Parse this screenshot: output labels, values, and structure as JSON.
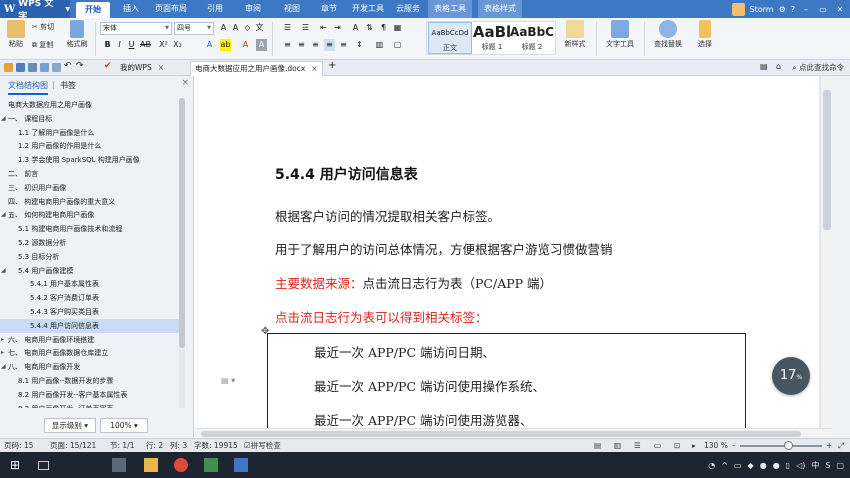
{
  "titlebar": {
    "app_name": "WPS 文字",
    "tabs": [
      "开始",
      "插入",
      "页面布局",
      "引用",
      "审阅",
      "视图",
      "章节",
      "开发工具",
      "云服务",
      "表格工具",
      "表格样式"
    ],
    "active_tab": "开始",
    "user": "Storm",
    "help": "?"
  },
  "ribbon": {
    "paste": "粘贴",
    "cut": "剪切",
    "copy": "复制",
    "format_painter": "格式刷",
    "font_name": "宋体",
    "font_size": "四号",
    "styles": [
      {
        "sample": "AaBbCcDd",
        "name": "正文"
      },
      {
        "sample": "AaBl",
        "name": "标题 1"
      },
      {
        "sample": "AaBbC",
        "name": "标题 2"
      }
    ],
    "new_style": "新样式",
    "text_tools": "文字工具",
    "find_replace": "查找替换",
    "select": "选择"
  },
  "tabbar": {
    "tabs": [
      {
        "label": "我的WPS",
        "active": false
      },
      {
        "label": "电商大数据应用之用户画像.docx",
        "active": true
      }
    ],
    "find_command": "点此查找命令"
  },
  "navpane": {
    "tabs": [
      "文档结构图",
      "书签"
    ],
    "items": [
      {
        "text": "电商大数据应用之用户画像",
        "level": 0,
        "prefix": ""
      },
      {
        "text": "一、  课程目标",
        "level": 0,
        "prefix": "◢"
      },
      {
        "text": "1.1  了解用户画像是什么",
        "level": 1,
        "prefix": ""
      },
      {
        "text": "1.2  用户画像的作用是什么",
        "level": 1,
        "prefix": ""
      },
      {
        "text": "1.3  学会使用 SparkSQL 构建用户画像",
        "level": 1,
        "prefix": ""
      },
      {
        "text": "二、  前言",
        "level": 0,
        "prefix": ""
      },
      {
        "text": "三、  初识用户画像",
        "level": 0,
        "prefix": ""
      },
      {
        "text": "四、  构建电商用户画像的重大意义",
        "level": 0,
        "prefix": ""
      },
      {
        "text": "五、  如何构建电商用户画像",
        "level": 0,
        "prefix": "◢"
      },
      {
        "text": "5.1  构建电商用户画像技术和流程",
        "level": 1,
        "prefix": ""
      },
      {
        "text": "5.2  源数据分析",
        "level": 1,
        "prefix": ""
      },
      {
        "text": "5.3  目标分析",
        "level": 1,
        "prefix": ""
      },
      {
        "text": "5.4  用户画像建模",
        "level": 1,
        "prefix": "◢"
      },
      {
        "text": "5.4.1  用户基本属性表",
        "level": 2,
        "prefix": ""
      },
      {
        "text": "5.4.2  客户消费订单表",
        "level": 2,
        "prefix": ""
      },
      {
        "text": "5.4.3  客户购买类目表",
        "level": 2,
        "prefix": ""
      },
      {
        "text": "5.4.4  用户访问信息表",
        "level": 2,
        "prefix": "",
        "selected": true
      },
      {
        "text": "六、  电商用户画像环境搭建",
        "level": 0,
        "prefix": "▸"
      },
      {
        "text": "七、  电商用户画像数据仓库建立",
        "level": 0,
        "prefix": "▸"
      },
      {
        "text": "八、  电商用户画像开发",
        "level": 0,
        "prefix": "◢"
      },
      {
        "text": "8.1 用户画像--数据开发的步骤",
        "level": 1,
        "prefix": ""
      },
      {
        "text": "8.2  用户画像开发--客户基本属性表",
        "level": 1,
        "prefix": ""
      },
      {
        "text": "8.3  用户画像开发--订单表宽表",
        "level": 1,
        "prefix": ""
      }
    ],
    "show_level": "显示级别",
    "zoom": "100%"
  },
  "document": {
    "heading": "5.4.4  用户访问信息表",
    "para1": "根据客户访问的情况提取相关客户标签。",
    "para2": "用于了解用户的访问总体情况，方便根据客户游览习惯做营销",
    "para3_label": "主要数据来源：",
    "para3_text": "点击流日志行为表（PC/APP 端）",
    "para4": "点击流日志行为表可以得到相关标签：",
    "table_lines": [
      "最近一次 APP/PC 端访问日期、",
      "最近一次 APP/PC 端访问使用操作系统、",
      "最近一次 APP/PC 端访问使用游览器、"
    ]
  },
  "progress": {
    "value": "17",
    "unit": "%"
  },
  "statusbar": {
    "page_num": "页码: 15",
    "pages": "页面: 15/121",
    "section": "节: 1/1",
    "row": "行: 2",
    "col": "列: 3",
    "words": "字数: 19915",
    "spell": "拼写检查",
    "zoom": "130 %"
  },
  "taskbar": {
    "ime": "中",
    "ime2": "S"
  },
  "colors": {
    "title_blue": "#3c78c3",
    "accent_red": "#e0241b",
    "selection": "#c7dbf5"
  }
}
